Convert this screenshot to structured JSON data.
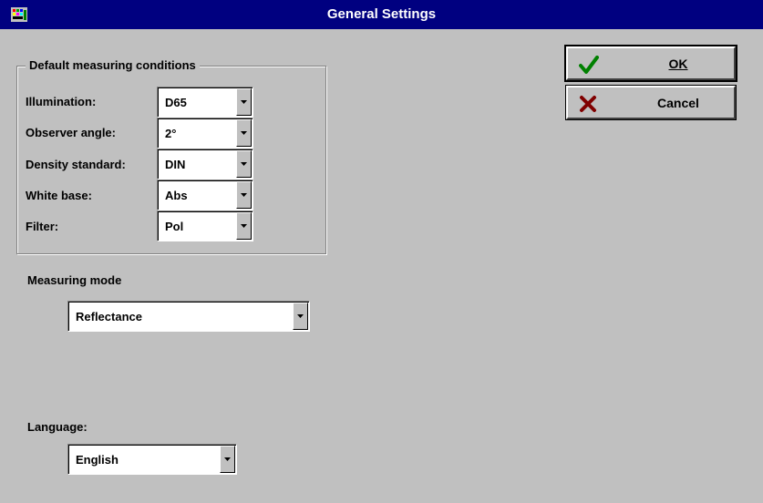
{
  "window": {
    "title": "General Settings"
  },
  "buttons": {
    "ok_label": "OK",
    "cancel_label": "Cancel"
  },
  "default_conditions": {
    "group_label": "Default measuring conditions",
    "illumination": {
      "label": "Illumination:",
      "value": "D65"
    },
    "observer_angle": {
      "label": "Observer angle:",
      "value": "2°"
    },
    "density_standard": {
      "label": "Density standard:",
      "value": "DIN"
    },
    "white_base": {
      "label": "White base:",
      "value": "Abs"
    },
    "filter": {
      "label": "Filter:",
      "value": "Pol"
    }
  },
  "measuring_mode": {
    "label": "Measuring mode",
    "value": "Reflectance"
  },
  "language": {
    "label": "Language:",
    "value": "English"
  },
  "colors": {
    "titlebar": "#000080",
    "face": "#c0c0c0",
    "ok_check": "#008000",
    "cancel_x": "#800000"
  }
}
